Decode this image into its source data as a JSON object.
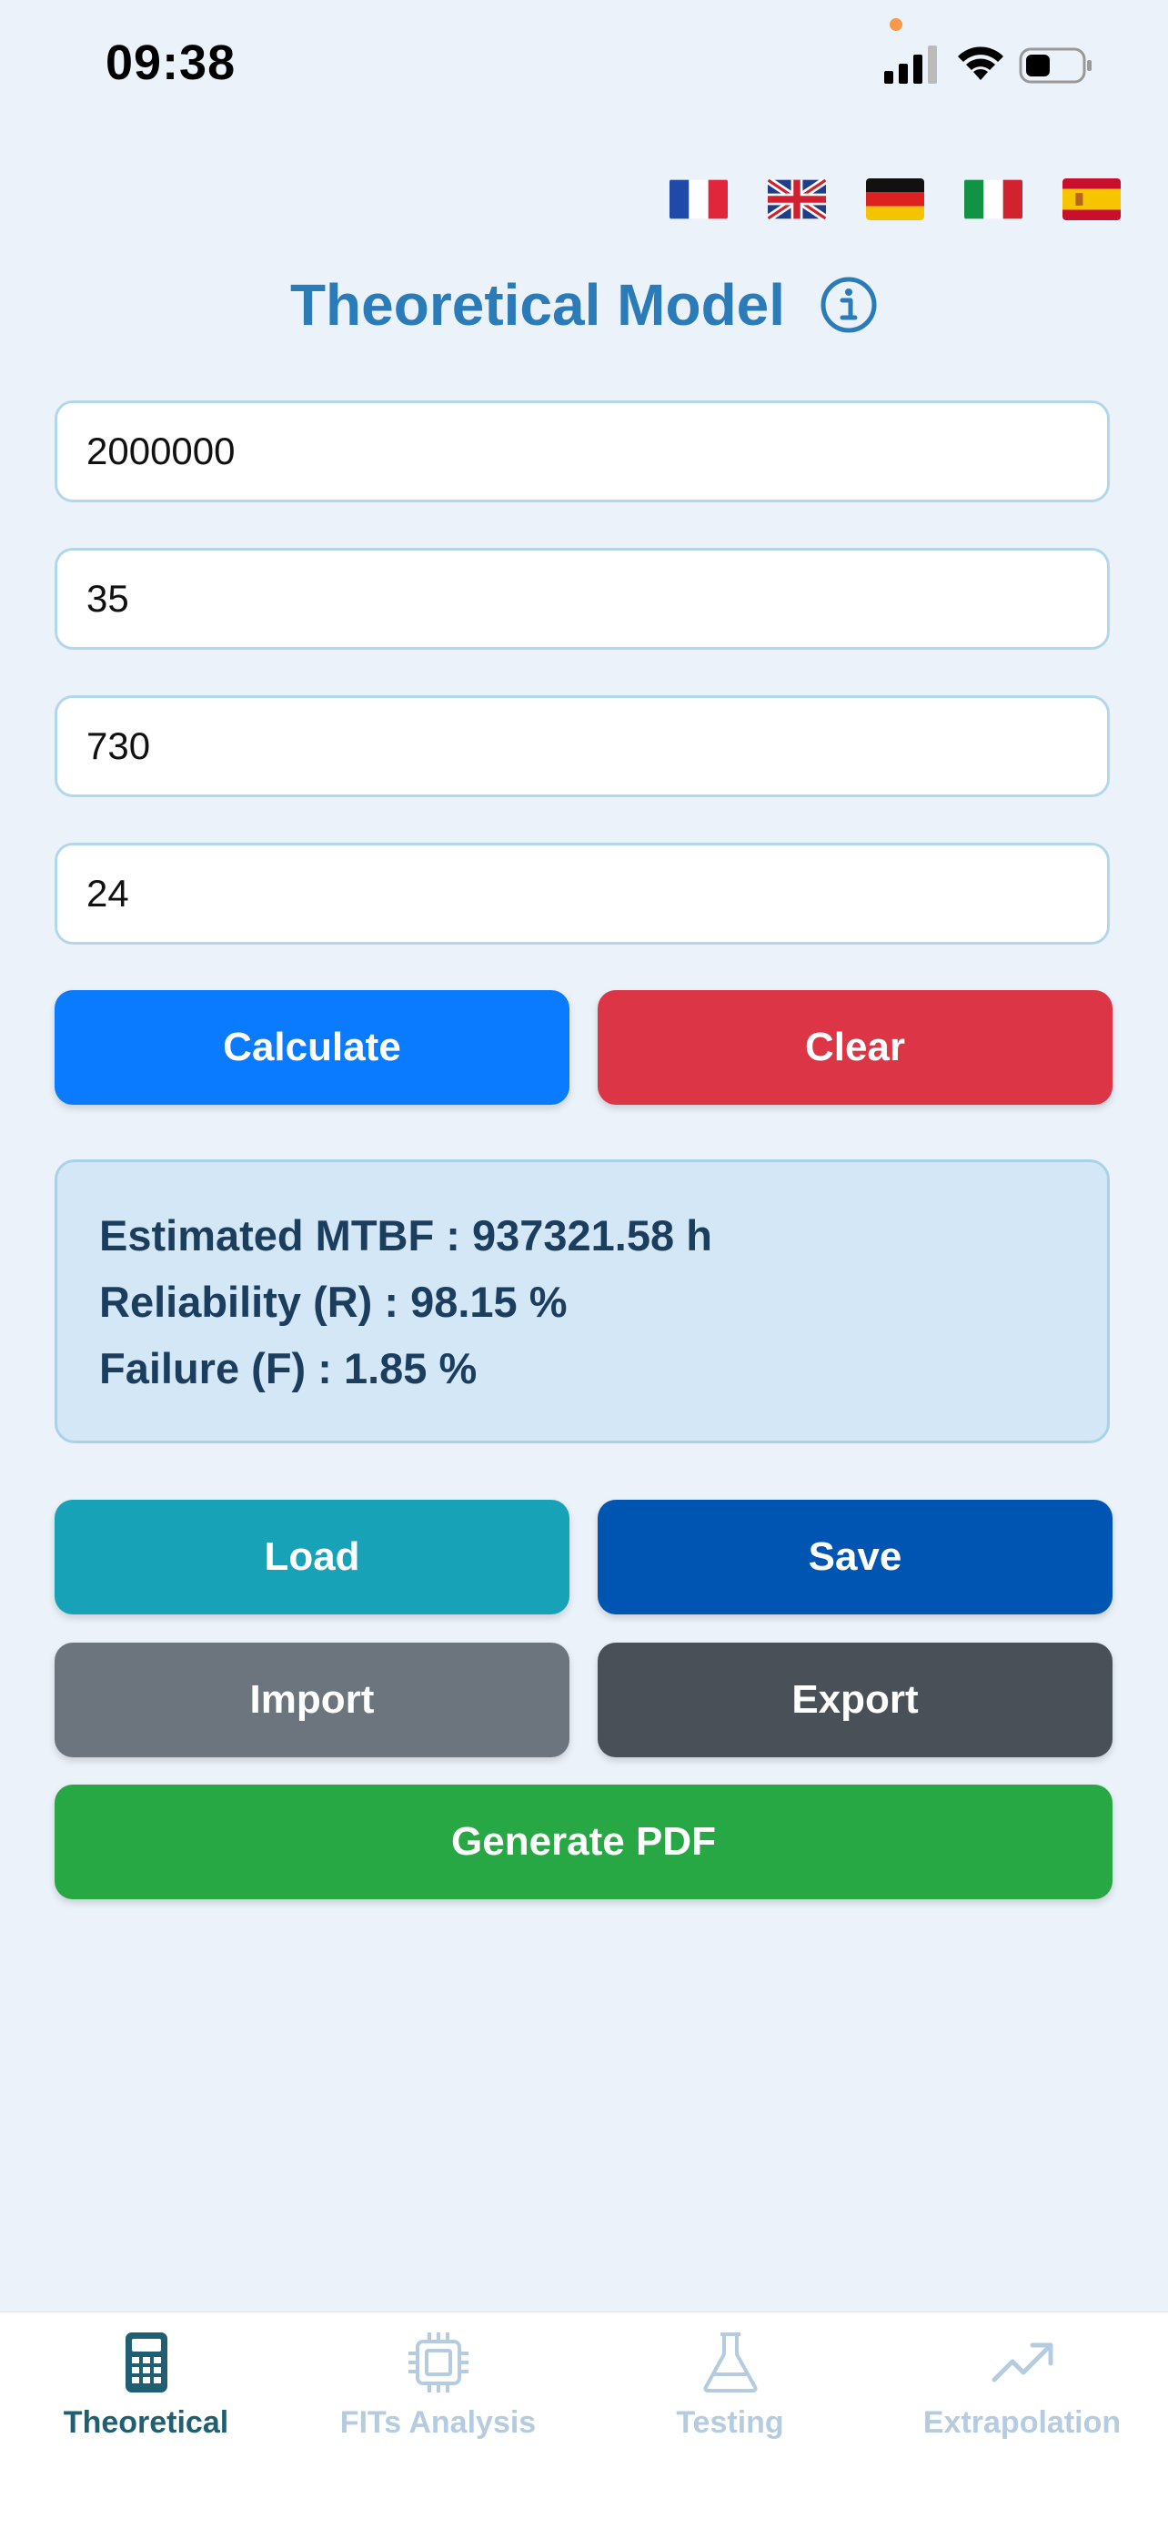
{
  "status_bar": {
    "time": "09:38"
  },
  "languages": [
    {
      "code": "fr",
      "icon": "flag-france-icon"
    },
    {
      "code": "en",
      "icon": "flag-uk-icon"
    },
    {
      "code": "de",
      "icon": "flag-germany-icon"
    },
    {
      "code": "it",
      "icon": "flag-italy-icon"
    },
    {
      "code": "es",
      "icon": "flag-spain-icon"
    }
  ],
  "header": {
    "title": "Theoretical Model",
    "info_icon": "info-circle-icon"
  },
  "inputs": [
    {
      "value": "2000000"
    },
    {
      "value": "35"
    },
    {
      "value": "730"
    },
    {
      "value": "24"
    }
  ],
  "actions": {
    "calculate": "Calculate",
    "clear": "Clear",
    "load": "Load",
    "save": "Save",
    "import": "Import",
    "export": "Export",
    "generate_pdf": "Generate PDF"
  },
  "results": {
    "mtbf": "Estimated MTBF : 937321.58 h",
    "reliability": "Reliability (R) : 98.15 %",
    "failure": "Failure (F) : 1.85 %"
  },
  "tabs": [
    {
      "label": "Theoretical",
      "icon": "calculator-icon",
      "active": true
    },
    {
      "label": "FITs Analysis",
      "icon": "chip-icon",
      "active": false
    },
    {
      "label": "Testing",
      "icon": "flask-icon",
      "active": false
    },
    {
      "label": "Extrapolation",
      "icon": "trend-up-icon",
      "active": false
    }
  ],
  "colors": {
    "background": "#ebf2fa",
    "title": "#2a7bb8",
    "calculate": "#0a7bff",
    "clear": "#dc3545",
    "load": "#17a2b8",
    "save": "#0055b3",
    "import": "#6c757d",
    "export": "#495057",
    "generate_pdf": "#28a745",
    "tab_active": "#1f5e73",
    "tab_inactive": "#b5cbe0"
  }
}
